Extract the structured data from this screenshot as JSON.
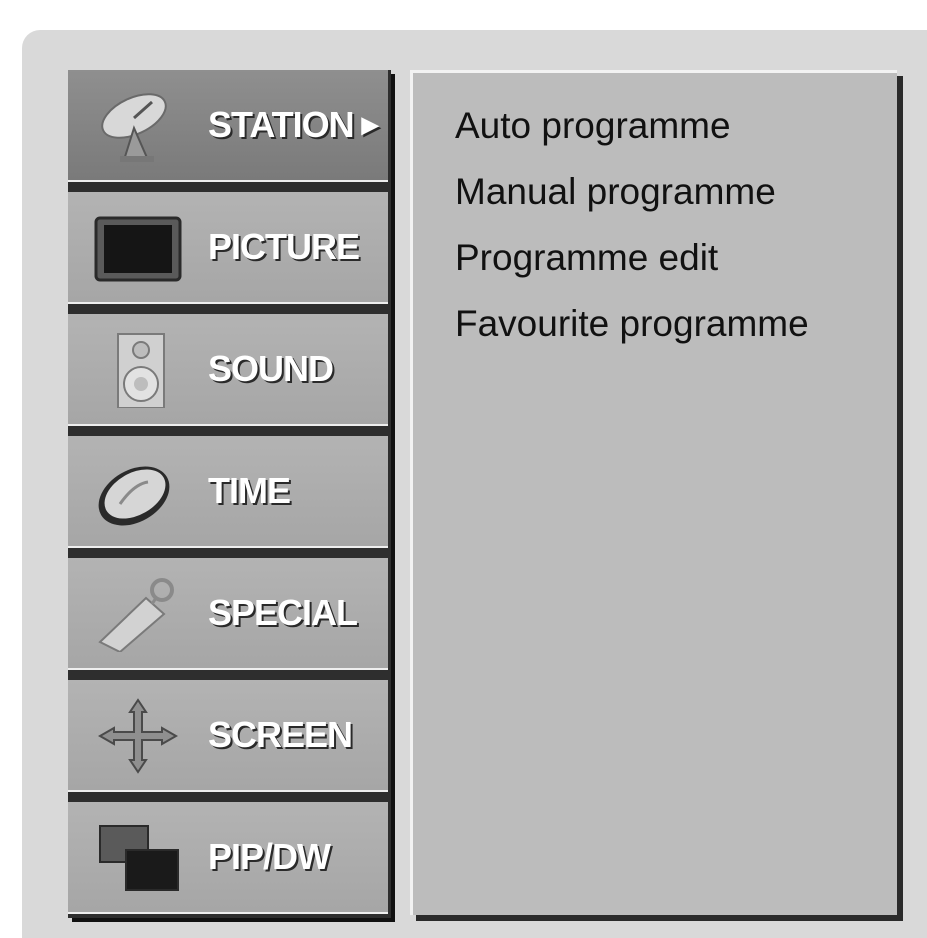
{
  "menu": {
    "items": [
      {
        "label": "STATION",
        "icon": "satellite-dish-icon",
        "selected": true,
        "has_submenu_arrow": true
      },
      {
        "label": "PICTURE",
        "icon": "tv-screen-icon",
        "selected": false
      },
      {
        "label": "SOUND",
        "icon": "speaker-icon",
        "selected": false
      },
      {
        "label": "TIME",
        "icon": "clock-disc-icon",
        "selected": false
      },
      {
        "label": "SPECIAL",
        "icon": "special-key-icon",
        "selected": false
      },
      {
        "label": "SCREEN",
        "icon": "move-arrows-icon",
        "selected": false
      },
      {
        "label": "PIP/DW",
        "icon": "pip-windows-icon",
        "selected": false
      }
    ],
    "arrow_glyph": "▶"
  },
  "submenu": {
    "items": [
      {
        "label": "Auto programme"
      },
      {
        "label": "Manual programme"
      },
      {
        "label": "Programme edit"
      },
      {
        "label": "Favourite programme"
      }
    ]
  },
  "colors": {
    "frame": "#d9d9d9",
    "menu_item": "#b0b0b0",
    "menu_item_selected": "#858585",
    "panel": "#bcbcbc",
    "label_text": "#ffffff",
    "submenu_text": "#111111"
  }
}
